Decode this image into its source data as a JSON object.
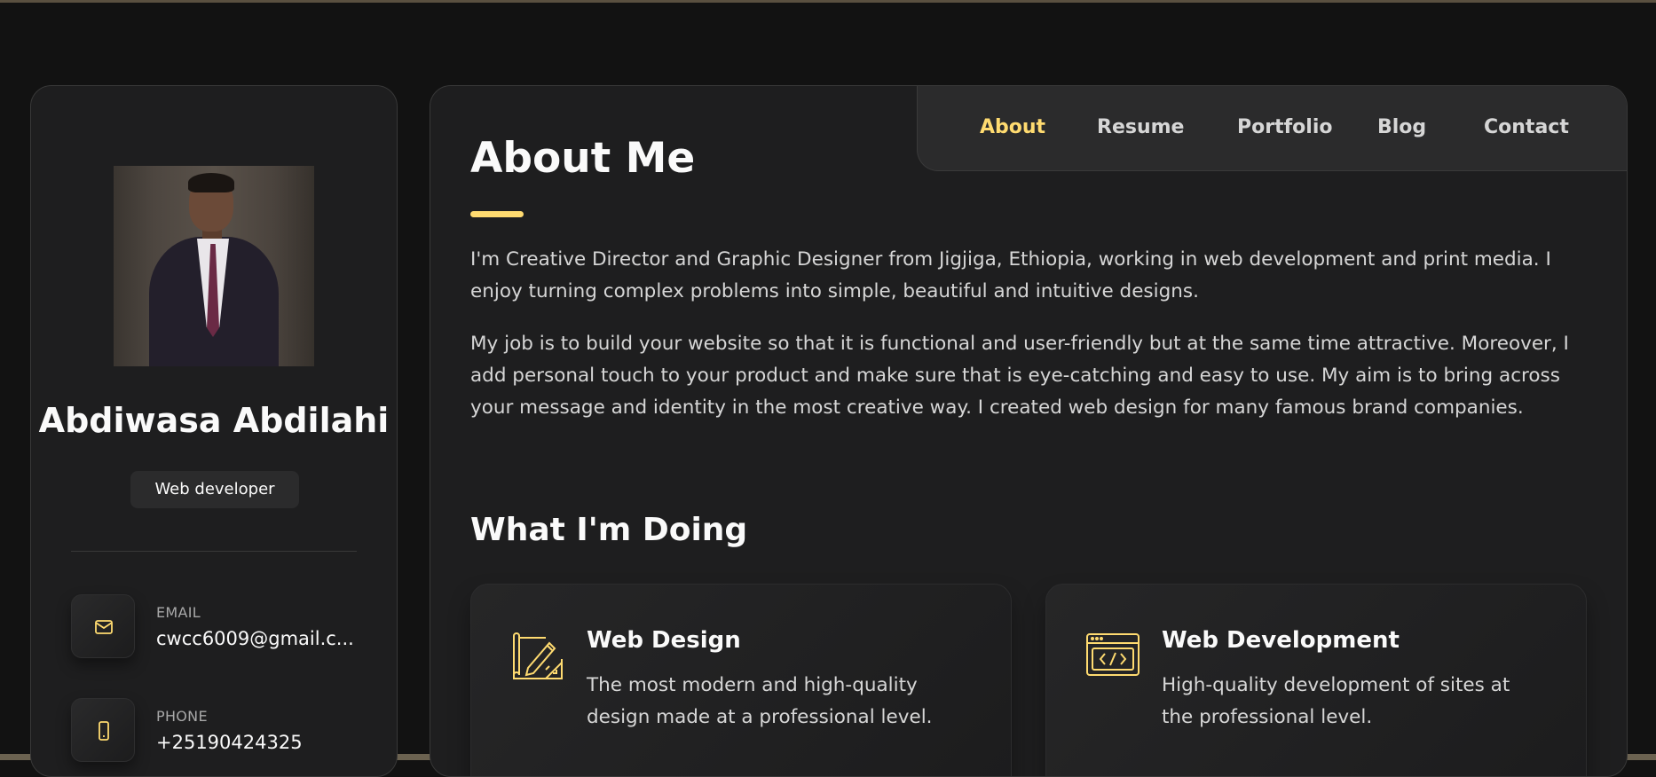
{
  "profile": {
    "name": "Abdiwasa Abdilahi",
    "title": "Web developer",
    "contacts": [
      {
        "label": "EMAIL",
        "value": "cwcc6009@gmail.c...",
        "icon": "mail-icon"
      },
      {
        "label": "PHONE",
        "value": "+25190424325",
        "icon": "phone-icon"
      }
    ]
  },
  "nav": {
    "items": [
      {
        "label": "About",
        "active": true
      },
      {
        "label": "Resume",
        "active": false
      },
      {
        "label": "Portfolio",
        "active": false
      },
      {
        "label": "Blog",
        "active": false
      },
      {
        "label": "Contact",
        "active": false
      }
    ]
  },
  "about": {
    "title": "About Me",
    "paragraphs": [
      "I'm Creative Director and Graphic Designer from Jigjiga, Ethiopia, working in web development and print media. I enjoy turning complex problems into simple, beautiful and intuitive designs.",
      "My job is to build your website so that it is functional and user-friendly but at the same time attractive. Moreover, I add personal touch to your product and make sure that is eye-catching and easy to use. My aim is to bring across your message and identity in the most creative way. I created web design for many famous brand companies."
    ]
  },
  "services": {
    "title": "What I'm Doing",
    "items": [
      {
        "title": "Web Design",
        "description": "The most modern and high-quality design made at a professional level.",
        "icon": "design-icon"
      },
      {
        "title": "Web Development",
        "description": "High-quality development of sites at the professional level.",
        "icon": "code-icon"
      }
    ]
  },
  "colors": {
    "accent": "#ffdb70",
    "background": "#121212",
    "panel": "#1e1e1f",
    "text": "#fafafa",
    "muted": "#d6d6d6"
  }
}
